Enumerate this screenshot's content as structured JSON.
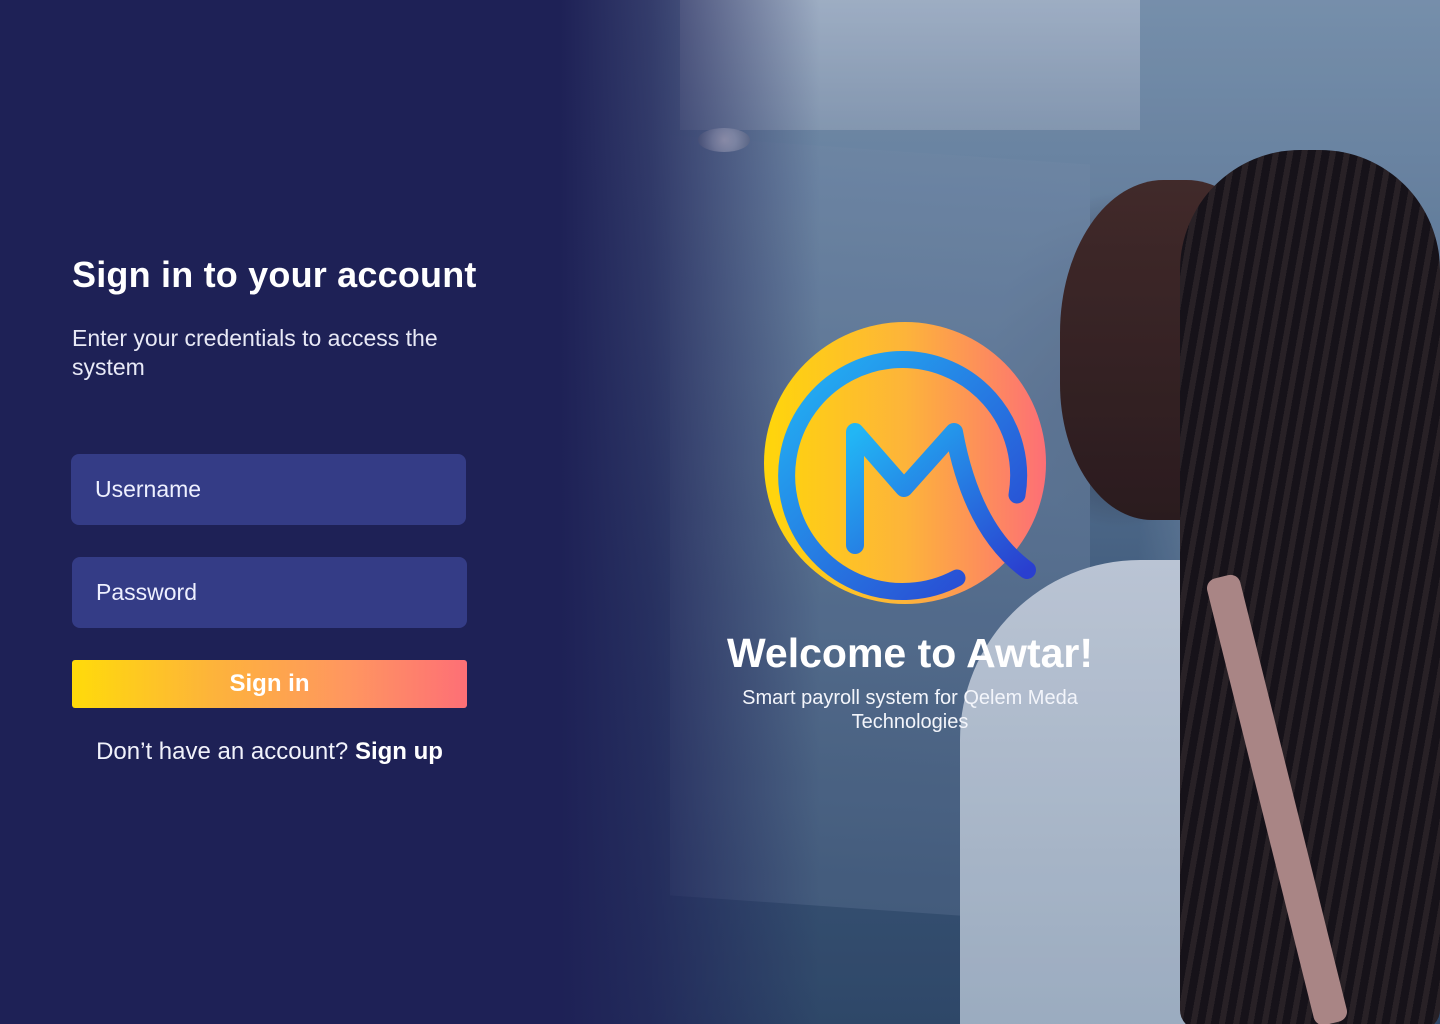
{
  "signin": {
    "title": "Sign in to your account",
    "subtitle": "Enter your credentials to access the system",
    "username_placeholder": "Username",
    "password_placeholder": "Password",
    "button_label": "Sign in",
    "no_account_text": "Don’t have an account?",
    "signup_label": "Sign up"
  },
  "brand": {
    "welcome": "Welcome to Awtar!",
    "tagline": "Smart payroll system for Qelem Meda Technologies",
    "logo_icon": "awtar-m-logo"
  },
  "colors": {
    "background": "#1e2156",
    "field": "#343c86",
    "gradient_start": "#ffdb0a",
    "gradient_end": "#fd6f76",
    "logo_blue": "#1f7ff0"
  }
}
